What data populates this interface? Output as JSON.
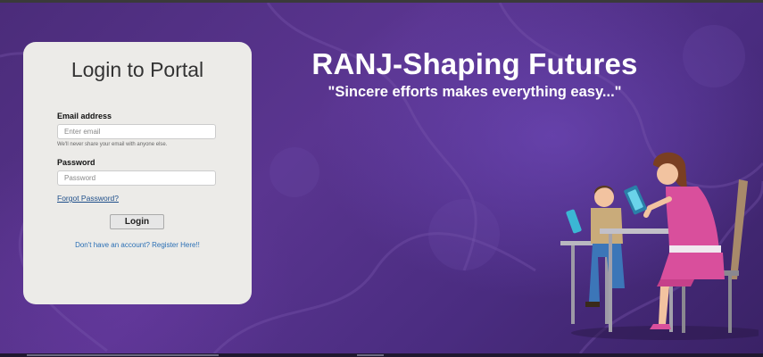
{
  "login": {
    "title": "Login to Portal",
    "email_label": "Email address",
    "email_placeholder": "Enter email",
    "email_value": "",
    "email_help": "We'll never share your email with anyone else.",
    "password_label": "Password",
    "password_placeholder": "Password",
    "password_value": "",
    "forgot_password": "Forgot Password?",
    "submit_label": "Login",
    "register_link": "Don't have an account? Register Here!!"
  },
  "hero": {
    "title": "RANJ-Shaping Futures",
    "tagline": "\"Sincere efforts makes everything easy...\""
  },
  "colors": {
    "background": "#4b2c7a",
    "card": "#ecebe8",
    "link": "#2a6fb5",
    "accent_pink": "#d94f9c"
  },
  "icons": {
    "illustration": "students-with-tablets-illustration"
  }
}
